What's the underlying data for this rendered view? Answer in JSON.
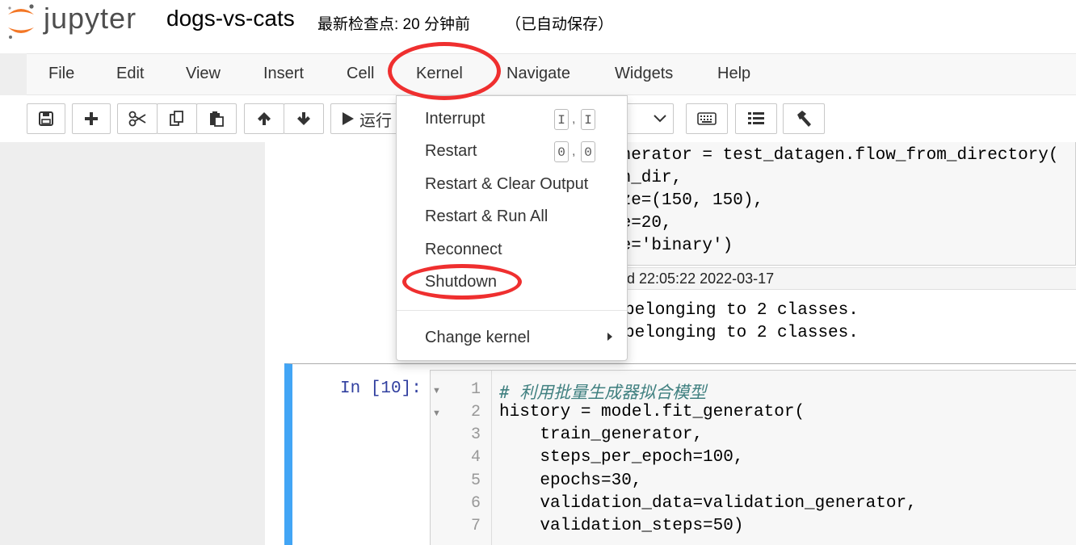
{
  "header": {
    "logo_text": "jupyter",
    "notebook_name": "dogs-vs-cats",
    "checkpoint": "最新检查点: 20 分钟前",
    "autosave": "（已自动保存）"
  },
  "menubar": {
    "items": [
      "File",
      "Edit",
      "View",
      "Insert",
      "Cell",
      "Kernel",
      "Navigate",
      "Widgets",
      "Help"
    ]
  },
  "toolbar": {
    "run_label": "运行",
    "icons": [
      "save-icon",
      "plus-icon",
      "scissors-icon",
      "copy-icon",
      "paste-icon",
      "arrow-up-icon",
      "arrow-down-icon",
      "play-icon",
      "chevron-down-icon",
      "keyboard-icon",
      "list-icon",
      "hammer-icon"
    ]
  },
  "kernel_menu": {
    "items": [
      {
        "label": "Interrupt",
        "shortcut": [
          "I",
          "I"
        ]
      },
      {
        "label": "Restart",
        "shortcut": [
          "0",
          "0"
        ]
      },
      {
        "label": "Restart & Clear Output"
      },
      {
        "label": "Restart & Run All"
      },
      {
        "label": "Reconnect"
      },
      {
        "label": "Shutdown"
      },
      {
        "label": "Change kernel"
      }
    ],
    "shortcut_separator": ","
  },
  "previous_cell": {
    "code_lines": [
      "enerator = test_datagen.flow_from_directory(",
      "on_dir,",
      "ize=(150, 150),",
      "ze=20,",
      "de='binary')"
    ],
    "exec_time": "d 22:05:22 2022-03-17",
    "output_lines": [
      "belonging to 2 classes.",
      "belonging to 2 classes."
    ]
  },
  "current_cell": {
    "prompt": "In [10]:",
    "line_numbers": [
      "1",
      "2",
      "3",
      "4",
      "5",
      "6",
      "7"
    ],
    "comment": "# 利用批量生成器拟合模型",
    "code_lines": [
      "history = model.fit_generator(",
      "    train_generator,",
      "    steps_per_epoch=100,",
      "    epochs=30,",
      "    validation_data=validation_generator,",
      "    validation_steps=50)"
    ]
  },
  "colors": {
    "annotation_red": "#ef2f2f",
    "selected_cell_blue": "#42a5f5",
    "prompt_blue": "#303f9f",
    "logo_orange": "#f37726"
  }
}
